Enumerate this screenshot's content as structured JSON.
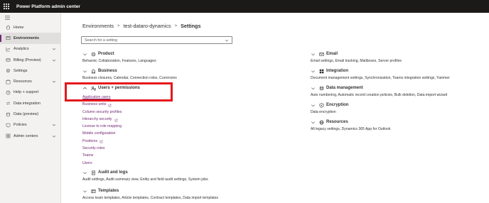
{
  "app": {
    "title": "Power Platform admin center"
  },
  "sidebar": {
    "items": [
      {
        "label": "Home",
        "icon": "home-icon",
        "expandable": false,
        "active": false
      },
      {
        "label": "Environments",
        "icon": "environments-icon",
        "expandable": false,
        "active": true
      },
      {
        "label": "Analytics",
        "icon": "analytics-icon",
        "expandable": true,
        "active": false
      },
      {
        "label": "Billing (Preview)",
        "icon": "billing-icon",
        "expandable": true,
        "active": false
      },
      {
        "label": "Settings",
        "icon": "gear-icon",
        "expandable": false,
        "active": false
      },
      {
        "label": "Resources",
        "icon": "resources-icon",
        "expandable": true,
        "active": false
      },
      {
        "label": "Help + support",
        "icon": "help-icon",
        "expandable": false,
        "active": false
      },
      {
        "label": "Data integration",
        "icon": "data-integration-icon",
        "expandable": false,
        "active": false
      },
      {
        "label": "Data (preview)",
        "icon": "database-icon",
        "expandable": false,
        "active": false
      },
      {
        "label": "Policies",
        "icon": "policies-icon",
        "expandable": true,
        "active": false
      },
      {
        "label": "Admin centers",
        "icon": "admin-centers-icon",
        "expandable": true,
        "active": false
      }
    ]
  },
  "breadcrumb": {
    "items": [
      "Environments",
      "test-dataro-dynamics"
    ],
    "current": "Settings"
  },
  "search": {
    "placeholder": "Search for a setting"
  },
  "sections_left": [
    {
      "title": "Product",
      "icon": "product-icon",
      "expanded": false,
      "description": "Behavior, Collaboration, Features, Languages"
    },
    {
      "title": "Business",
      "icon": "business-icon",
      "expanded": false,
      "description": "Business closures, Calendar, Connection roles, Currencies"
    },
    {
      "title": "Users + permissions",
      "icon": "users-permissions-icon",
      "expanded": true,
      "links": [
        {
          "label": "Application users",
          "external": false
        },
        {
          "label": "Business units",
          "external": true
        },
        {
          "label": "Column security profiles",
          "external": false
        },
        {
          "label": "Hierarchy security",
          "external": true
        },
        {
          "label": "License to role mapping",
          "external": false
        },
        {
          "label": "Mobile configuration",
          "external": false
        },
        {
          "label": "Positions",
          "external": true
        },
        {
          "label": "Security roles",
          "external": false
        },
        {
          "label": "Teams",
          "external": false
        },
        {
          "label": "Users",
          "external": false
        }
      ]
    },
    {
      "title": "Audit and logs",
      "icon": "audit-icon",
      "expanded": false,
      "description": "Audit settings, Audit summary view, Entity and field audit settings, System jobs"
    },
    {
      "title": "Templates",
      "icon": "templates-icon",
      "expanded": false,
      "description": "Access team templates, Article templates, Contract templates, Data import templates"
    }
  ],
  "sections_right": [
    {
      "title": "Email",
      "icon": "mail-icon",
      "expanded": false,
      "description": "Email settings, Email tracking, Mailboxes, Server profiles"
    },
    {
      "title": "Integration",
      "icon": "integration-icon",
      "expanded": false,
      "description": "Document management settings, Synchronization, Teams integration settings, Yammer"
    },
    {
      "title": "Data management",
      "icon": "data-management-icon",
      "expanded": false,
      "description": "Auto numbering, Automatic record creation policies, Bulk deletion, Data import wizard"
    },
    {
      "title": "Encryption",
      "icon": "encryption-icon",
      "expanded": false,
      "description": "Data encryption"
    },
    {
      "title": "Resources",
      "icon": "globe-icon",
      "expanded": false,
      "description": "All legacy settings, Dynamics 365 App for Outlook"
    }
  ],
  "colors": {
    "accent": "#742774",
    "highlight": "#e5171c",
    "topbar": "#1b1a19"
  }
}
